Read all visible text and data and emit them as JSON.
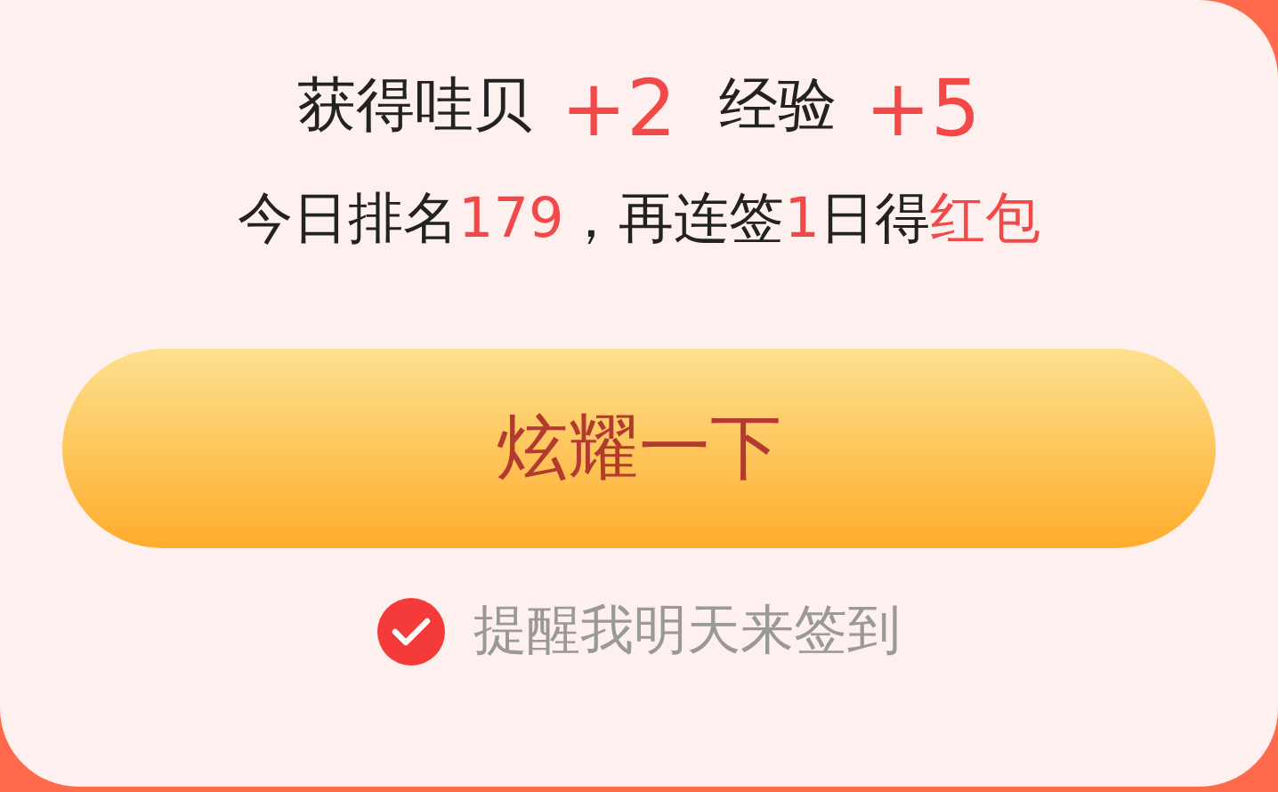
{
  "rewards": [
    {
      "label": "获得哇贝",
      "value": "+2"
    },
    {
      "label": "经验",
      "value": "+5"
    }
  ],
  "rank_line": [
    {
      "text": "今日排名",
      "highlight": false
    },
    {
      "text": "179",
      "highlight": true
    },
    {
      "text": "，再连签",
      "highlight": false
    },
    {
      "text": "1",
      "highlight": true
    },
    {
      "text": "日得",
      "highlight": false
    },
    {
      "text": "红包",
      "highlight": true
    }
  ],
  "share_button": {
    "label": "炫耀一下"
  },
  "reminder": {
    "label": "提醒我明天来签到",
    "checked": true
  }
}
